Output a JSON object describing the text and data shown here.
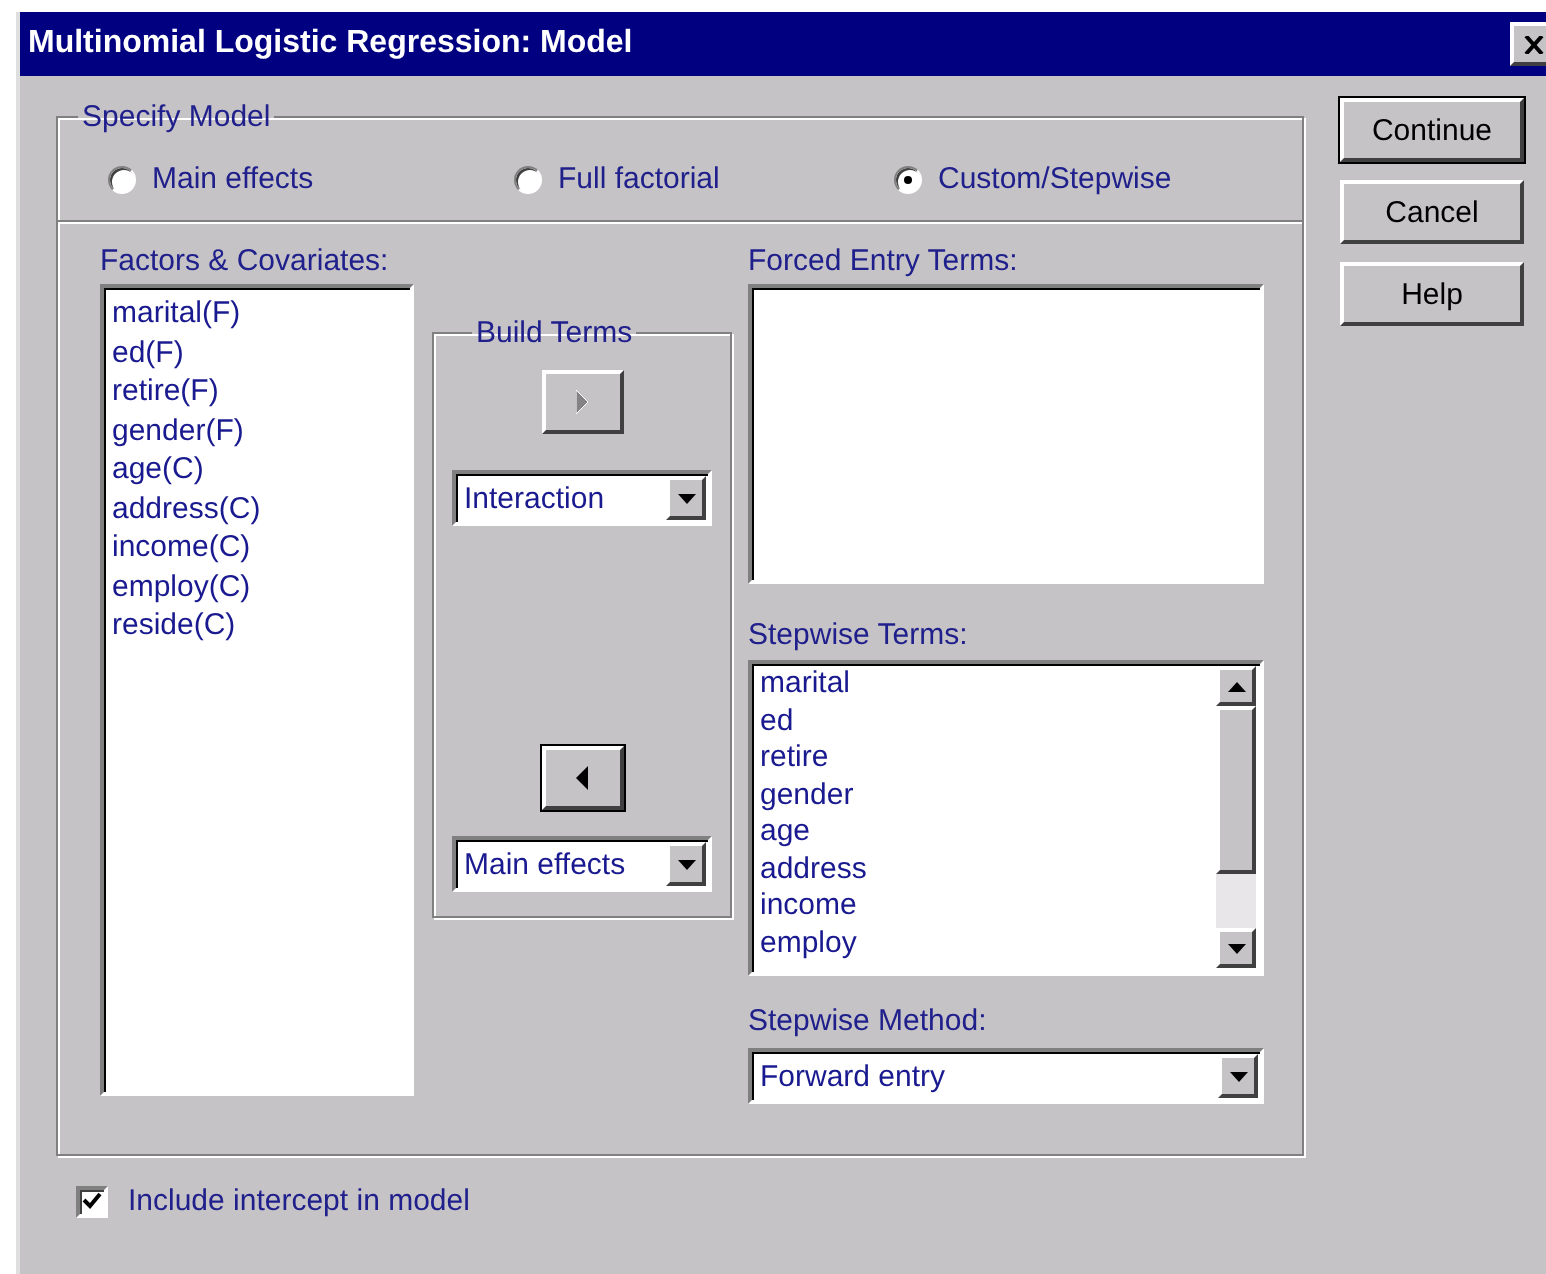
{
  "window": {
    "title": "Multinomial Logistic Regression: Model"
  },
  "specify_model": {
    "legend": "Specify Model",
    "options": [
      {
        "label": "Main effects",
        "selected": false
      },
      {
        "label": "Full factorial",
        "selected": false
      },
      {
        "label": "Custom/Stepwise",
        "selected": true
      }
    ]
  },
  "factors_covariates": {
    "label": "Factors & Covariates:",
    "items": [
      "marital(F)",
      "ed(F)",
      "retire(F)",
      "gender(F)",
      "age(C)",
      "address(C)",
      "income(C)",
      "employ(C)",
      "reside(C)"
    ]
  },
  "build_terms": {
    "legend": "Build Terms",
    "add_button": {
      "disabled": true
    },
    "add_type": "Interaction",
    "remove_button": {
      "disabled": false
    },
    "remove_type": "Main effects"
  },
  "forced_entry_terms": {
    "label": "Forced Entry Terms:"
  },
  "stepwise_terms": {
    "label": "Stepwise Terms:",
    "items": [
      "marital",
      "ed",
      "retire",
      "gender",
      "age",
      "address",
      "income",
      "employ"
    ]
  },
  "stepwise_method": {
    "label": "Stepwise Method:",
    "value": "Forward entry"
  },
  "include_intercept": {
    "label": "Include intercept in model",
    "checked": true
  },
  "buttons": [
    "Continue",
    "Cancel",
    "Help"
  ]
}
